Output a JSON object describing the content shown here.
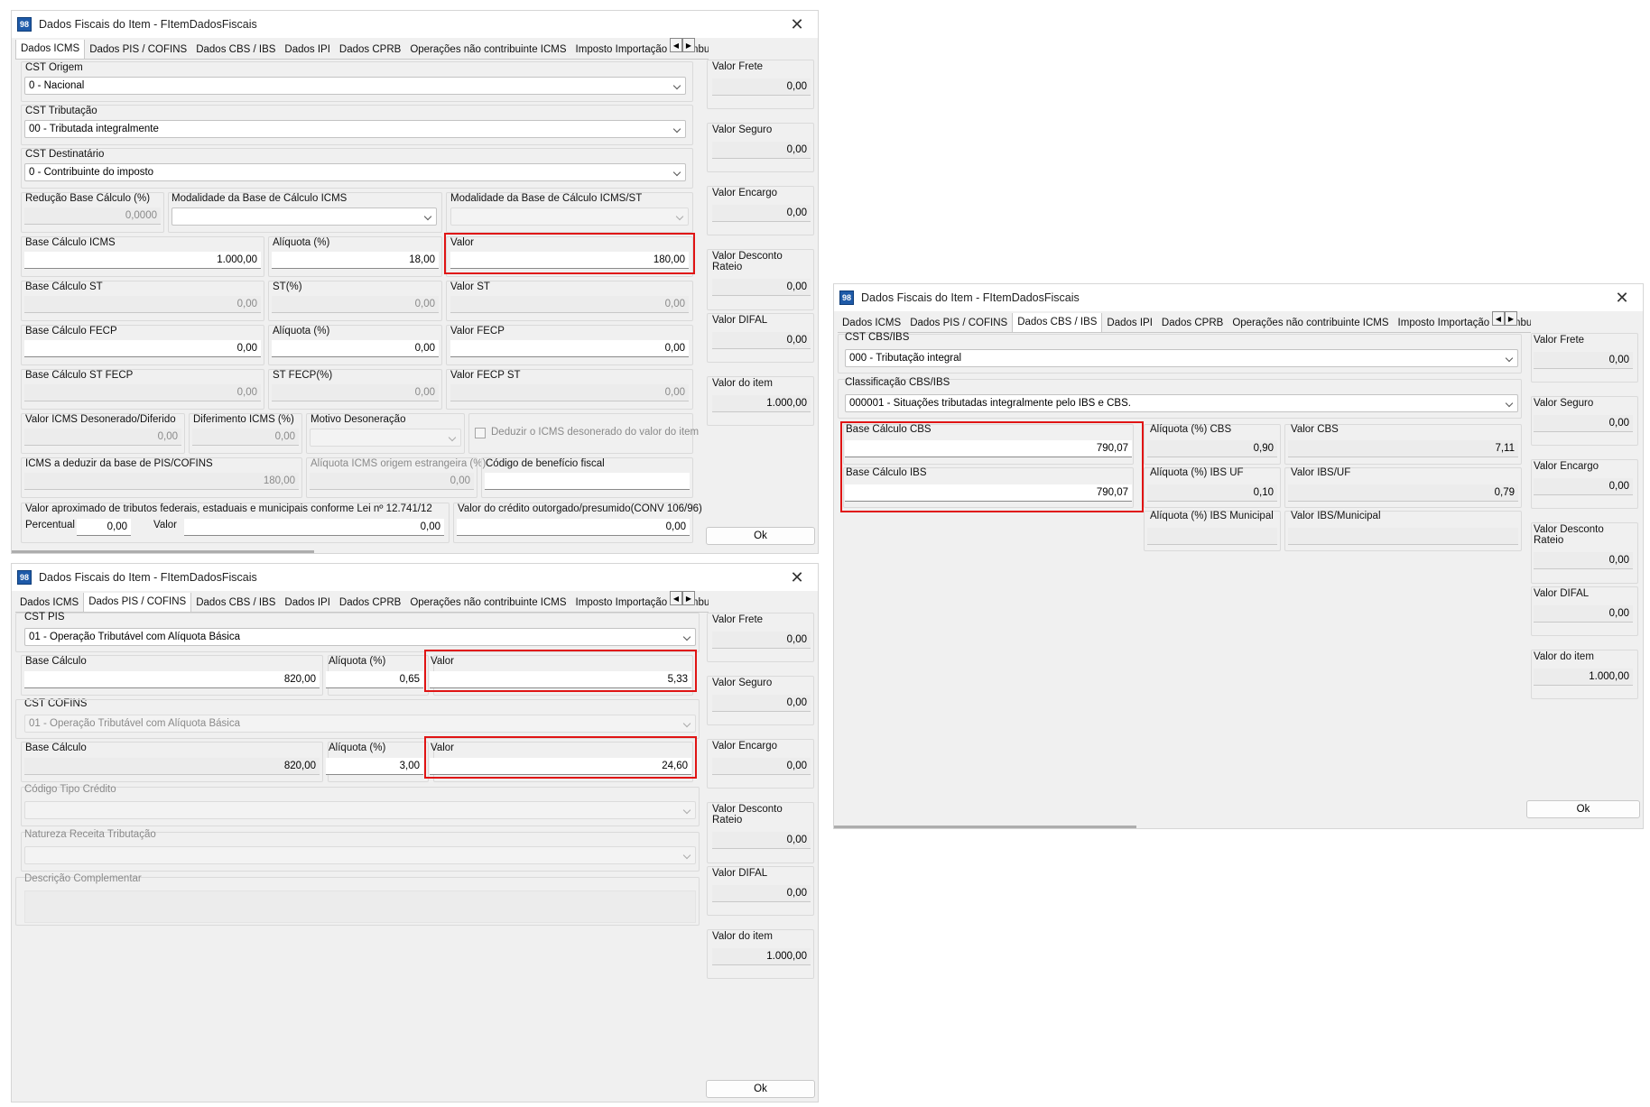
{
  "w1": {
    "title": "Dados Fiscais do Item - FItemDadosFiscais",
    "tabs": [
      "Dados ICMS",
      "Dados PIS / COFINS",
      "Dados CBS / IBS",
      "Dados IPI",
      "Dados CPRB",
      "Operações não contribuinte ICMS",
      "Imposto Importação",
      "Combu"
    ],
    "cst_origem": {
      "label": "CST Origem",
      "value": "0 - Nacional"
    },
    "cst_tributacao": {
      "label": "CST Tributação",
      "value": "00 - Tributada integralmente"
    },
    "cst_destinatario": {
      "label": "CST Destinatário",
      "value": "0 - Contribuinte do imposto"
    },
    "reducao": {
      "label": "Redução Base Cálculo (%)",
      "value": "0,0000"
    },
    "modalidade_icms": {
      "label": "Modalidade da Base de Cálculo ICMS",
      "value": ""
    },
    "modalidade_st": {
      "label": "Modalidade da Base de Cálculo ICMS/ST",
      "value": ""
    },
    "base_icms": {
      "label": "Base Cálculo ICMS",
      "value": "1.000,00"
    },
    "aliquota": {
      "label": "Alíquota (%)",
      "value": "18,00"
    },
    "valor": {
      "label": "Valor",
      "value": "180,00"
    },
    "base_st": {
      "label": "Base Cálculo ST",
      "value": "0,00"
    },
    "st_pct": {
      "label": "ST(%)",
      "value": "0,00"
    },
    "valor_st": {
      "label": "Valor ST",
      "value": "0,00"
    },
    "base_fecp": {
      "label": "Base Cálculo FECP",
      "value": "0,00"
    },
    "aliquota_fecp": {
      "label": "Alíquota (%)",
      "value": "0,00"
    },
    "valor_fecp": {
      "label": "Valor FECP",
      "value": "0,00"
    },
    "base_st_fecp": {
      "label": "Base Cálculo ST FECP",
      "value": "0,00"
    },
    "st_fecp_pct": {
      "label": "ST FECP(%)",
      "value": "0,00"
    },
    "valor_fecp_st": {
      "label": "Valor FECP ST",
      "value": "0,00"
    },
    "icms_desonerado": {
      "label": "Valor ICMS Desonerado/Diferido",
      "value": "0,00"
    },
    "diferimento": {
      "label": "Diferimento ICMS (%)",
      "value": "0,00"
    },
    "motivo": {
      "label": "Motivo Desoneração",
      "value": ""
    },
    "deduzir": {
      "label": "Deduzir o ICMS desonerado do valor do item"
    },
    "icms_deduzir": {
      "label": "ICMS a deduzir da base de PIS/COFINS",
      "value": "180,00"
    },
    "aliquota_estrangeira": {
      "label": "Alíquota ICMS origem estrangeira (%)",
      "value": "0,00"
    },
    "codigo_beneficio": {
      "label": "Código de benefício fiscal",
      "value": ""
    },
    "valor_aprox": {
      "label": "Valor aproximado de tributos federais, estaduais e municipais conforme Lei nº 12.741/12",
      "percentual_label": "Percentual",
      "percentual": "0,00",
      "valor_label": "Valor",
      "valor": "0,00"
    },
    "credito_outorgado": {
      "label": "Valor do crédito outorgado/presumido(CONV 106/96)",
      "value": "0,00"
    }
  },
  "w2": {
    "title": "Dados Fiscais do Item - FItemDadosFiscais",
    "tabs": [
      "Dados ICMS",
      "Dados PIS / COFINS",
      "Dados CBS / IBS",
      "Dados IPI",
      "Dados CPRB",
      "Operações não contribuinte ICMS",
      "Imposto Importação",
      "Combu"
    ],
    "cst_pis": {
      "label": "CST PIS",
      "value": "01 - Operação Tributável com Alíquota Básica"
    },
    "pis_base": {
      "label": "Base Cálculo",
      "value": "820,00"
    },
    "pis_aliquota": {
      "label": "Alíquota (%)",
      "value": "0,65"
    },
    "pis_valor": {
      "label": "Valor",
      "value": "5,33"
    },
    "cst_cofins": {
      "label": "CST COFINS",
      "value": "01 - Operação Tributável com Alíquota Básica"
    },
    "cofins_base": {
      "label": "Base Cálculo",
      "value": "820,00"
    },
    "cofins_aliquota": {
      "label": "Alíquota (%)",
      "value": "3,00"
    },
    "cofins_valor": {
      "label": "Valor",
      "value": "24,60"
    },
    "codigo_tipo_credito": {
      "label": "Código Tipo Crédito"
    },
    "natureza_receita": {
      "label": "Natureza Receita Tributação"
    },
    "descricao": {
      "label": "Descrição Complementar"
    }
  },
  "w3": {
    "title": "Dados Fiscais do Item - FItemDadosFiscais",
    "tabs": [
      "Dados ICMS",
      "Dados PIS / COFINS",
      "Dados CBS / IBS",
      "Dados IPI",
      "Dados CPRB",
      "Operações não contribuinte ICMS",
      "Imposto Importação",
      "Combu"
    ],
    "cst_cbs_ibs": {
      "label": "CST CBS/IBS",
      "value": "000 - Tributação integral"
    },
    "classificacao": {
      "label": "Classificação CBS/IBS",
      "value": "000001 - Situações tributadas integralmente pelo IBS e CBS."
    },
    "base_cbs": {
      "label": "Base Cálculo CBS",
      "value": "790,07"
    },
    "base_ibs": {
      "label": "Base Cálculo IBS",
      "value": "790,07"
    },
    "aliq_cbs": {
      "label": "Alíquota (%) CBS",
      "value": "0,90"
    },
    "valor_cbs": {
      "label": "Valor CBS",
      "value": "7,11"
    },
    "aliq_ibs_uf": {
      "label": "Alíquota (%) IBS UF",
      "value": "0,10"
    },
    "valor_ibs_uf": {
      "label": "Valor IBS/UF",
      "value": "0,79"
    },
    "aliq_ibs_mun": {
      "label": "Alíquota (%) IBS Municipal",
      "value": ""
    },
    "valor_ibs_mun": {
      "label": "Valor IBS/Municipal",
      "value": ""
    }
  },
  "side": {
    "frete": {
      "label": "Valor Frete",
      "value": "0,00"
    },
    "seguro": {
      "label": "Valor Seguro",
      "value": "0,00"
    },
    "encargo": {
      "label": "Valor Encargo",
      "value": "0,00"
    },
    "desconto": {
      "label1": "Valor Desconto",
      "label2": "Rateio",
      "value": "0,00"
    },
    "difal": {
      "label": "Valor DIFAL",
      "value": "0,00"
    },
    "item": {
      "label": "Valor do item",
      "value": "1.000,00"
    },
    "ok": "Ok"
  },
  "highlight_color": "#e01414",
  "app_icon_text": "98"
}
